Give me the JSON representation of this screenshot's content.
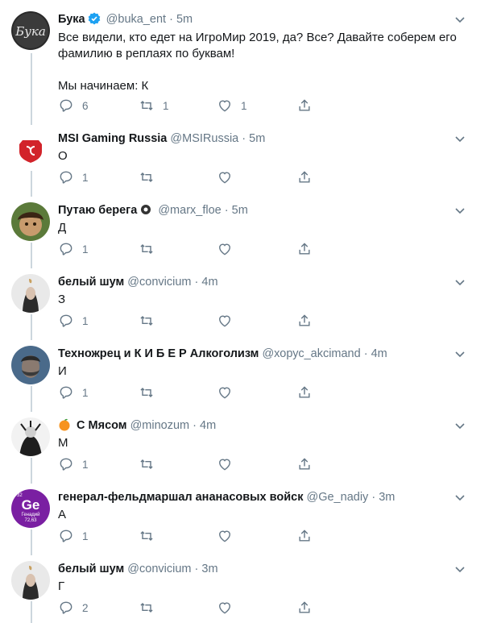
{
  "tweets": [
    {
      "name": "Бука",
      "verified": true,
      "handle": "@buka_ent",
      "dot": "·",
      "time": "5m",
      "text_lines": [
        "Все видели, кто едет на ИгроМир 2019, да? Все? Давайте соберем его",
        "фамилию в реплаях по буквам!",
        "",
        "Мы начинаем: К"
      ],
      "replies": "6",
      "retweets": "1",
      "likes": "1",
      "avatar_label": "Бука"
    },
    {
      "name": "MSI Gaming Russia",
      "handle": "@MSIRussia",
      "dot": "·",
      "time": "5m",
      "text_lines": [
        "О"
      ],
      "replies": "1",
      "retweets": "",
      "likes": ""
    },
    {
      "name": "Путаю берега",
      "handle": "@marx_floe",
      "dot": "·",
      "time": "5m",
      "text_lines": [
        "Д"
      ],
      "replies": "1",
      "retweets": "",
      "likes": ""
    },
    {
      "name": "белый шум",
      "handle": "@convicium",
      "dot": "·",
      "time": "4m",
      "text_lines": [
        "З"
      ],
      "replies": "1",
      "retweets": "",
      "likes": ""
    },
    {
      "name": "Техножрец и К И Б Е Р Алкоголизм",
      "handle": "@хорус_akcimand",
      "dot": "·",
      "time": "4m",
      "text_lines": [
        "И"
      ],
      "replies": "1",
      "retweets": "",
      "likes": ""
    },
    {
      "name": "С Мясом",
      "handle": "@minozum",
      "dot": "·",
      "time": "4m",
      "text_lines": [
        "М"
      ],
      "replies": "1",
      "retweets": "",
      "likes": ""
    },
    {
      "name": "генерал-фельдмаршал ананасовых войск",
      "handle": "@Ge_nadiy",
      "dot": "·",
      "time": "3m",
      "text_lines": [
        "А"
      ],
      "replies": "1",
      "retweets": "",
      "likes": "",
      "avatar_tile": {
        "number": "32",
        "symbol": "Ge",
        "name": "Генадий",
        "mass": "72,63"
      }
    },
    {
      "name": "белый шум",
      "handle": "@convicium",
      "dot": "·",
      "time": "3m",
      "text_lines": [
        "Г"
      ],
      "replies": "2",
      "retweets": "",
      "likes": ""
    }
  ],
  "colors": {
    "text": "#14171a",
    "muted": "#657786",
    "verified": "#1da1f2",
    "thread_line": "#ccd6dd",
    "msi_red": "#d2232a",
    "ge_purple": "#7a1fa2"
  }
}
